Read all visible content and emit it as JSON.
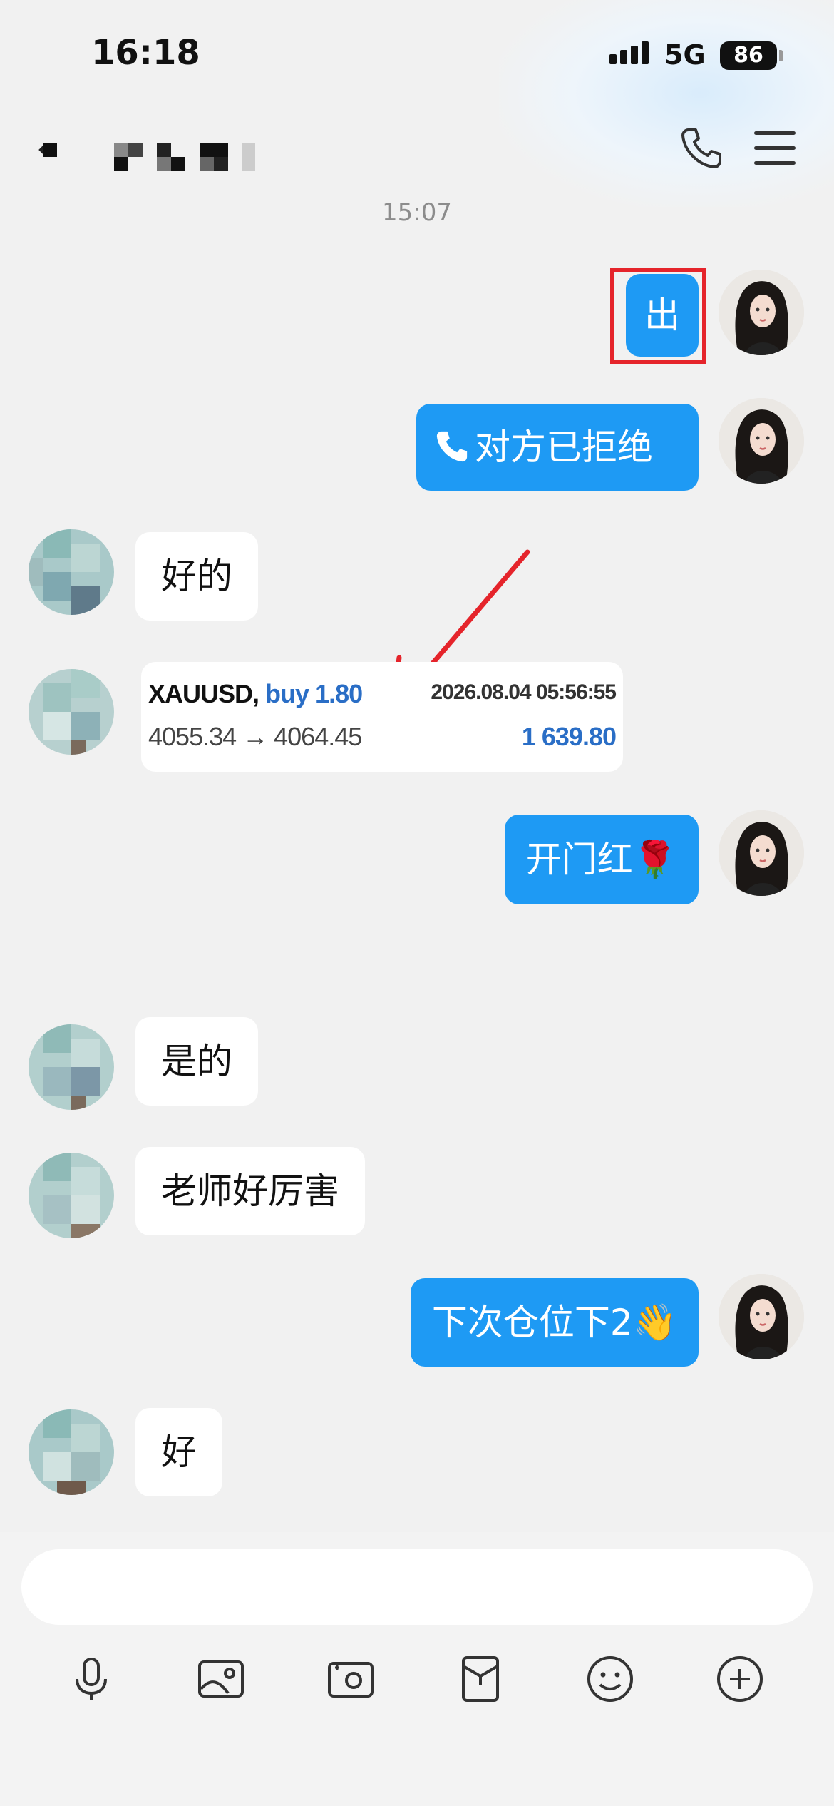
{
  "status_bar": {
    "time": "16:18",
    "network": "5G",
    "battery": "86"
  },
  "header": {
    "contact_name": ""
  },
  "chat": {
    "timestamp": "15:07",
    "messages": [
      {
        "from": "me",
        "text": "出"
      },
      {
        "from": "me",
        "text": "对方已拒绝"
      },
      {
        "from": "other",
        "text": "好的"
      },
      {
        "from": "other",
        "type": "trade-card"
      },
      {
        "from": "me",
        "text": "开门红🌹"
      },
      {
        "from": "other",
        "text": "是的"
      },
      {
        "from": "other",
        "text": "老师好厉害"
      },
      {
        "from": "me",
        "text": "下次仓位下2👋"
      },
      {
        "from": "other",
        "text": "好"
      }
    ]
  },
  "trade": {
    "symbol": "XAUUSD,",
    "side": "buy 1.80",
    "datetime": "2026.08.04 05:56:55",
    "prices": "4055.34 → 4064.45",
    "profit": "1 639.80"
  },
  "colors": {
    "bubble_out": "#1e9af4",
    "highlight": "#e5242b",
    "profit": "#2a6ec6"
  },
  "toolbar": {
    "icons": [
      "microphone-icon",
      "image-icon",
      "camera-icon",
      "red-packet-icon",
      "emoji-icon",
      "plus-icon"
    ]
  }
}
